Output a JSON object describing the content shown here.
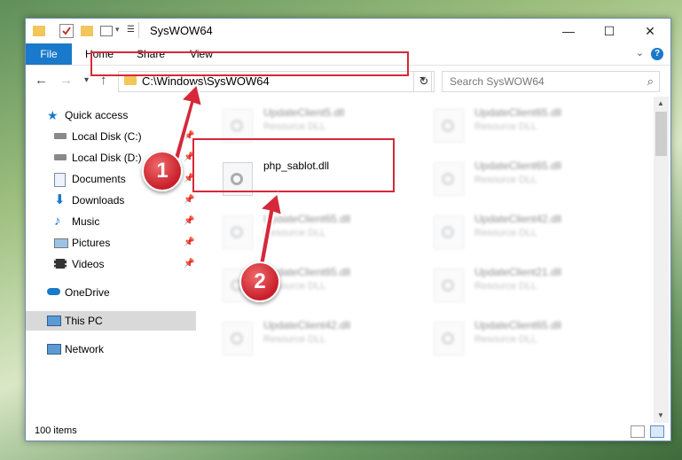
{
  "window": {
    "title": "SysWOW64"
  },
  "ribbon": {
    "tabs": [
      "File",
      "Home",
      "Share",
      "View"
    ]
  },
  "nav": {
    "address": "C:\\Windows\\SysWOW64",
    "search_placeholder": "Search SysWOW64"
  },
  "sidebar": {
    "items": [
      {
        "label": "Quick access",
        "icon": "star-icon",
        "pinned": false
      },
      {
        "label": "Local Disk (C:)",
        "icon": "drive-icon",
        "pinned": true
      },
      {
        "label": "Local Disk (D:)",
        "icon": "drive-icon",
        "pinned": true
      },
      {
        "label": "Documents",
        "icon": "documents-icon",
        "pinned": true
      },
      {
        "label": "Downloads",
        "icon": "download-icon",
        "pinned": true
      },
      {
        "label": "Music",
        "icon": "music-icon",
        "pinned": true
      },
      {
        "label": "Pictures",
        "icon": "pictures-icon",
        "pinned": true
      },
      {
        "label": "Videos",
        "icon": "videos-icon",
        "pinned": true
      },
      {
        "label": "OneDrive",
        "icon": "cloud-icon",
        "pinned": false
      },
      {
        "label": "This PC",
        "icon": "computer-icon",
        "pinned": false,
        "selected": true
      },
      {
        "label": "Network",
        "icon": "network-icon",
        "pinned": false
      }
    ]
  },
  "files": {
    "left": [
      {
        "name": "UpdateClient5.dll",
        "type": "Resource DLL"
      },
      {
        "name": "php_sablot.dll",
        "type": ""
      },
      {
        "name": "UpdateClient65.dll",
        "type": "Resource DLL"
      },
      {
        "name": "UpdateClient65.dll",
        "type": "Resource DLL"
      },
      {
        "name": "UpdateClient42.dll",
        "type": "Resource DLL"
      }
    ],
    "right": [
      {
        "name": "UpdateClient65.dll",
        "type": "Resource DLL"
      },
      {
        "name": "UpdateClient65.dll",
        "type": "Resource DLL"
      },
      {
        "name": "UpdateClient42.dll",
        "type": "Resource DLL"
      },
      {
        "name": "UpdateClient21.dll",
        "type": "Resource DLL"
      },
      {
        "name": "UpdateClient65.dll",
        "type": "Resource DLL"
      }
    ]
  },
  "status": {
    "item_count": "100 items"
  },
  "annotations": {
    "badge1": "1",
    "badge2": "2"
  },
  "colors": {
    "accent": "#1979ca",
    "highlight": "#d6283a"
  }
}
